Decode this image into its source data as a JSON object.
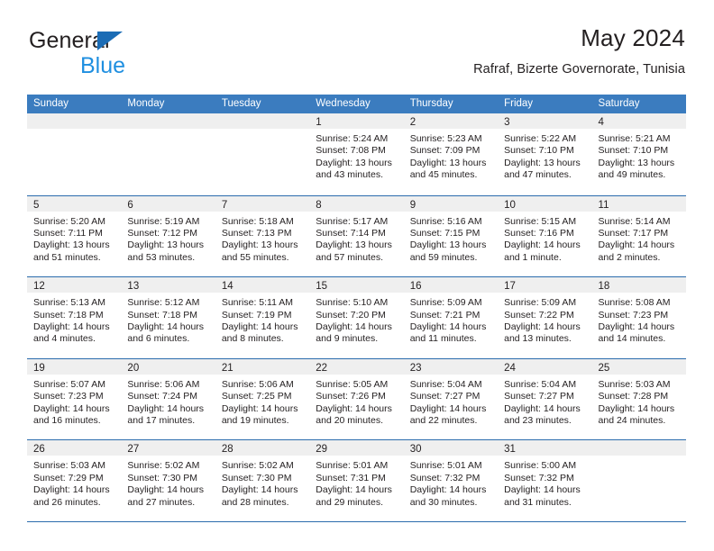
{
  "brand": {
    "name_part1": "General",
    "name_part2": "Blue",
    "logo_icon": "triangle-logo-icon",
    "accent_color": "#1b6cb5",
    "accent_color_light": "#1f8fe0"
  },
  "header": {
    "title": "May 2024",
    "subtitle": "Rafraf, Bizerte Governorate, Tunisia"
  },
  "calendar": {
    "header_bg": "#3b7cbf",
    "daynum_bg": "#efefef",
    "row_separator_color": "#2b6cad",
    "weekdays": [
      "Sunday",
      "Monday",
      "Tuesday",
      "Wednesday",
      "Thursday",
      "Friday",
      "Saturday"
    ],
    "weeks": [
      [
        {
          "day": "",
          "lines": []
        },
        {
          "day": "",
          "lines": []
        },
        {
          "day": "",
          "lines": []
        },
        {
          "day": "1",
          "lines": [
            "Sunrise: 5:24 AM",
            "Sunset: 7:08 PM",
            "Daylight: 13 hours",
            "and 43 minutes."
          ]
        },
        {
          "day": "2",
          "lines": [
            "Sunrise: 5:23 AM",
            "Sunset: 7:09 PM",
            "Daylight: 13 hours",
            "and 45 minutes."
          ]
        },
        {
          "day": "3",
          "lines": [
            "Sunrise: 5:22 AM",
            "Sunset: 7:10 PM",
            "Daylight: 13 hours",
            "and 47 minutes."
          ]
        },
        {
          "day": "4",
          "lines": [
            "Sunrise: 5:21 AM",
            "Sunset: 7:10 PM",
            "Daylight: 13 hours",
            "and 49 minutes."
          ]
        }
      ],
      [
        {
          "day": "5",
          "lines": [
            "Sunrise: 5:20 AM",
            "Sunset: 7:11 PM",
            "Daylight: 13 hours",
            "and 51 minutes."
          ]
        },
        {
          "day": "6",
          "lines": [
            "Sunrise: 5:19 AM",
            "Sunset: 7:12 PM",
            "Daylight: 13 hours",
            "and 53 minutes."
          ]
        },
        {
          "day": "7",
          "lines": [
            "Sunrise: 5:18 AM",
            "Sunset: 7:13 PM",
            "Daylight: 13 hours",
            "and 55 minutes."
          ]
        },
        {
          "day": "8",
          "lines": [
            "Sunrise: 5:17 AM",
            "Sunset: 7:14 PM",
            "Daylight: 13 hours",
            "and 57 minutes."
          ]
        },
        {
          "day": "9",
          "lines": [
            "Sunrise: 5:16 AM",
            "Sunset: 7:15 PM",
            "Daylight: 13 hours",
            "and 59 minutes."
          ]
        },
        {
          "day": "10",
          "lines": [
            "Sunrise: 5:15 AM",
            "Sunset: 7:16 PM",
            "Daylight: 14 hours",
            "and 1 minute."
          ]
        },
        {
          "day": "11",
          "lines": [
            "Sunrise: 5:14 AM",
            "Sunset: 7:17 PM",
            "Daylight: 14 hours",
            "and 2 minutes."
          ]
        }
      ],
      [
        {
          "day": "12",
          "lines": [
            "Sunrise: 5:13 AM",
            "Sunset: 7:18 PM",
            "Daylight: 14 hours",
            "and 4 minutes."
          ]
        },
        {
          "day": "13",
          "lines": [
            "Sunrise: 5:12 AM",
            "Sunset: 7:18 PM",
            "Daylight: 14 hours",
            "and 6 minutes."
          ]
        },
        {
          "day": "14",
          "lines": [
            "Sunrise: 5:11 AM",
            "Sunset: 7:19 PM",
            "Daylight: 14 hours",
            "and 8 minutes."
          ]
        },
        {
          "day": "15",
          "lines": [
            "Sunrise: 5:10 AM",
            "Sunset: 7:20 PM",
            "Daylight: 14 hours",
            "and 9 minutes."
          ]
        },
        {
          "day": "16",
          "lines": [
            "Sunrise: 5:09 AM",
            "Sunset: 7:21 PM",
            "Daylight: 14 hours",
            "and 11 minutes."
          ]
        },
        {
          "day": "17",
          "lines": [
            "Sunrise: 5:09 AM",
            "Sunset: 7:22 PM",
            "Daylight: 14 hours",
            "and 13 minutes."
          ]
        },
        {
          "day": "18",
          "lines": [
            "Sunrise: 5:08 AM",
            "Sunset: 7:23 PM",
            "Daylight: 14 hours",
            "and 14 minutes."
          ]
        }
      ],
      [
        {
          "day": "19",
          "lines": [
            "Sunrise: 5:07 AM",
            "Sunset: 7:23 PM",
            "Daylight: 14 hours",
            "and 16 minutes."
          ]
        },
        {
          "day": "20",
          "lines": [
            "Sunrise: 5:06 AM",
            "Sunset: 7:24 PM",
            "Daylight: 14 hours",
            "and 17 minutes."
          ]
        },
        {
          "day": "21",
          "lines": [
            "Sunrise: 5:06 AM",
            "Sunset: 7:25 PM",
            "Daylight: 14 hours",
            "and 19 minutes."
          ]
        },
        {
          "day": "22",
          "lines": [
            "Sunrise: 5:05 AM",
            "Sunset: 7:26 PM",
            "Daylight: 14 hours",
            "and 20 minutes."
          ]
        },
        {
          "day": "23",
          "lines": [
            "Sunrise: 5:04 AM",
            "Sunset: 7:27 PM",
            "Daylight: 14 hours",
            "and 22 minutes."
          ]
        },
        {
          "day": "24",
          "lines": [
            "Sunrise: 5:04 AM",
            "Sunset: 7:27 PM",
            "Daylight: 14 hours",
            "and 23 minutes."
          ]
        },
        {
          "day": "25",
          "lines": [
            "Sunrise: 5:03 AM",
            "Sunset: 7:28 PM",
            "Daylight: 14 hours",
            "and 24 minutes."
          ]
        }
      ],
      [
        {
          "day": "26",
          "lines": [
            "Sunrise: 5:03 AM",
            "Sunset: 7:29 PM",
            "Daylight: 14 hours",
            "and 26 minutes."
          ]
        },
        {
          "day": "27",
          "lines": [
            "Sunrise: 5:02 AM",
            "Sunset: 7:30 PM",
            "Daylight: 14 hours",
            "and 27 minutes."
          ]
        },
        {
          "day": "28",
          "lines": [
            "Sunrise: 5:02 AM",
            "Sunset: 7:30 PM",
            "Daylight: 14 hours",
            "and 28 minutes."
          ]
        },
        {
          "day": "29",
          "lines": [
            "Sunrise: 5:01 AM",
            "Sunset: 7:31 PM",
            "Daylight: 14 hours",
            "and 29 minutes."
          ]
        },
        {
          "day": "30",
          "lines": [
            "Sunrise: 5:01 AM",
            "Sunset: 7:32 PM",
            "Daylight: 14 hours",
            "and 30 minutes."
          ]
        },
        {
          "day": "31",
          "lines": [
            "Sunrise: 5:00 AM",
            "Sunset: 7:32 PM",
            "Daylight: 14 hours",
            "and 31 minutes."
          ]
        },
        {
          "day": "",
          "lines": []
        }
      ]
    ]
  }
}
